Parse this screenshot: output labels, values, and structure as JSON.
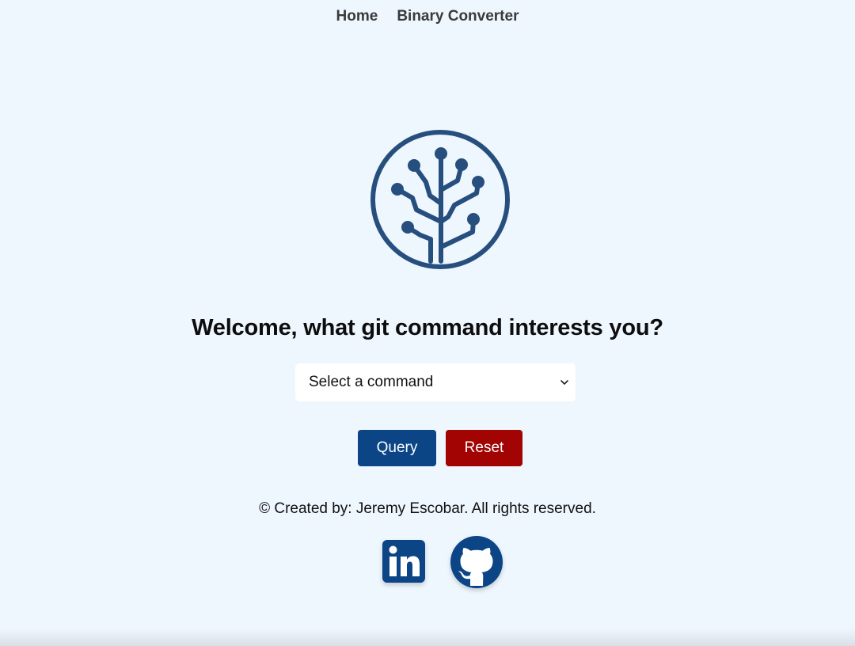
{
  "nav": {
    "items": [
      {
        "label": "Home"
      },
      {
        "label": "Binary Converter"
      }
    ]
  },
  "logo": {
    "icon": "git-tree-logo-icon",
    "color": "#274f7e"
  },
  "main": {
    "heading": "Welcome, what git command interests you?",
    "select": {
      "selected_label": "Select a command"
    },
    "buttons": {
      "query_label": "Query",
      "reset_label": "Reset"
    }
  },
  "footer": {
    "copyright": "© Created by: Jeremy Escobar. All rights reserved."
  },
  "social": {
    "linkedin_icon": "linkedin-icon",
    "github_icon": "github-icon",
    "color": "#0b4586"
  },
  "colors": {
    "background": "#eef6fe",
    "query_button": "#0b4586",
    "reset_button": "#a20404"
  }
}
